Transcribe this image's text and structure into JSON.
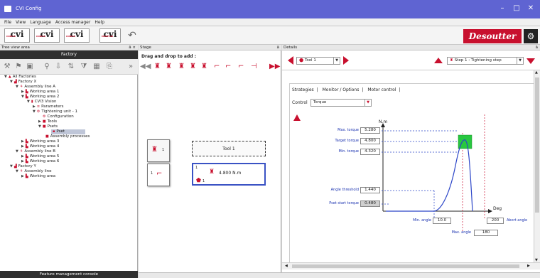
{
  "app": {
    "title": "CVI Config",
    "colors": {
      "titlebar": "#5f64d2",
      "accent": "#c8102e",
      "selection": "#3a52c4"
    }
  },
  "window_controls": {
    "minimize": "–",
    "maximize": "□",
    "close": "✕"
  },
  "menu": [
    "File",
    "View",
    "Language",
    "Access manager",
    "Help"
  ],
  "toolbar": {
    "buttons": [
      {
        "label": "cvi",
        "caption": "CONFIG"
      },
      {
        "label": "cvi",
        "caption": "CONFIG"
      },
      {
        "label": "cvi",
        "caption": "CONFIG"
      },
      {
        "label": "cvi",
        "caption": "MONITOR"
      }
    ],
    "undo_icon": "undo-icon",
    "brand": "Desoutter"
  },
  "left_panel": {
    "header": "Tree view area",
    "pin": "ā ×",
    "factory_label": "Factory",
    "footer": "Feature management console",
    "tree": [
      {
        "label": "All Factories",
        "level": 0,
        "icon": "factory-icon",
        "exp": "▼"
      },
      {
        "label": "Factory X",
        "level": 1,
        "icon": "factory-icon",
        "exp": "▼"
      },
      {
        "label": "Assembly line A",
        "level": 2,
        "icon": "line-icon",
        "exp": "▼"
      },
      {
        "label": "Working area 1",
        "level": 3,
        "icon": "station-icon",
        "exp": "▶"
      },
      {
        "label": "Working area 2",
        "level": 3,
        "icon": "station-icon",
        "exp": "▼"
      },
      {
        "label": "CVI3 Vision",
        "level": 4,
        "icon": "controller-icon",
        "exp": "▼"
      },
      {
        "label": "Parameters",
        "level": 5,
        "icon": "parameters-icon",
        "exp": "▶"
      },
      {
        "label": "Tightening unit - 1",
        "level": 5,
        "icon": "tightening-unit-icon",
        "exp": "▼"
      },
      {
        "label": "Configuration",
        "level": 6,
        "icon": "configuration-icon",
        "exp": ""
      },
      {
        "label": "Tools",
        "level": 6,
        "icon": "tools-icon",
        "exp": "▶"
      },
      {
        "label": "Psets",
        "level": 6,
        "icon": "psets-icon",
        "exp": "▼"
      },
      {
        "label": "Pset",
        "level": 7,
        "icon": "pset-icon",
        "exp": "",
        "selected": true
      },
      {
        "label": "Assembly processes",
        "level": 6,
        "icon": "assembly-process-icon",
        "exp": ""
      },
      {
        "label": "Working area 3",
        "level": 3,
        "icon": "station-icon",
        "exp": "▶"
      },
      {
        "label": "Working area 4",
        "level": 3,
        "icon": "station-icon",
        "exp": "▶"
      },
      {
        "label": "Assembly line B",
        "level": 2,
        "icon": "line-icon",
        "exp": "▼"
      },
      {
        "label": "Working area 5",
        "level": 3,
        "icon": "station-icon",
        "exp": "▶"
      },
      {
        "label": "Working area 6",
        "level": 3,
        "icon": "station-icon",
        "exp": "▶"
      },
      {
        "label": "Factory Y",
        "level": 1,
        "icon": "factory-icon",
        "exp": "▼"
      },
      {
        "label": "Assembly line",
        "level": 2,
        "icon": "line-icon",
        "exp": "▼"
      },
      {
        "label": "Working area",
        "level": 3,
        "icon": "station-icon",
        "exp": "▶"
      }
    ]
  },
  "stage": {
    "header": "Stage",
    "pin": "ā",
    "drag_label": "Drag and drop to add :",
    "block1_value": "1",
    "block2_value": "1",
    "tool_label": "Tool 1",
    "pset_index": "1",
    "pset_torque": "4.800 N.m",
    "pset_sub": "1"
  },
  "details": {
    "header": "Details",
    "pin": "ā",
    "tool_combo": "Tool 1",
    "step_combo": "Step 1 : Tightening step",
    "tabs": [
      "Strategies",
      "Monitor / Options",
      "Motor control"
    ],
    "control_label": "Control",
    "control_value": "Torque",
    "y_unit": "N.m",
    "x_unit": "Deg",
    "max_torque_label": "Max. torque",
    "max_torque": "5.280",
    "target_torque_label": "Target torque",
    "target_torque": "4.800",
    "min_torque_label": "Min. torque",
    "min_torque": "4.320",
    "angle_threshold_label": "Angle threshold",
    "angle_threshold": "1.440",
    "pset_start_torque_label": "Pset start torque",
    "pset_start_torque": "0.480",
    "min_angle_label": "Min. angle",
    "min_angle": "10.0",
    "abort_angle_value": "200",
    "abort_angle_label": "Abort angle",
    "max_angle_label": "Max. angle",
    "max_angle": "180"
  }
}
